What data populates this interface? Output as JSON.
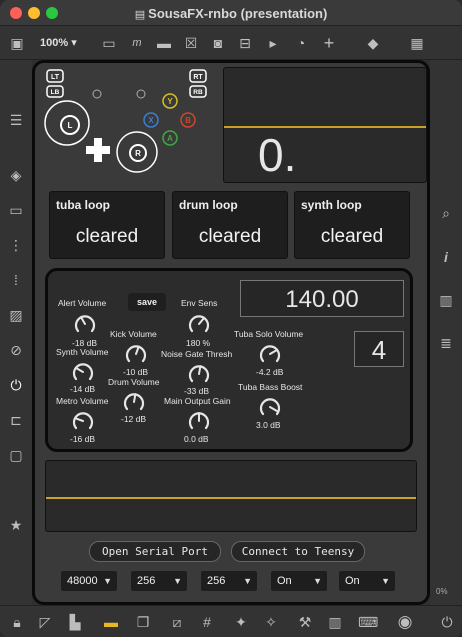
{
  "window": {
    "title": "SousaFX-rnbo (presentation)",
    "zoom": "100%"
  },
  "colors": {
    "accent": "#c9a227",
    "close": "#fe5f57",
    "minimize": "#febc2e",
    "maximize": "#28c840",
    "display_line": "#c9a227"
  },
  "toolbar": {
    "icons": [
      "sidebar-toggle-icon",
      "zoom-dropdown",
      "comment-box-icon",
      "message-icon",
      "speech-icon",
      "toggle-x-icon",
      "number-box-icon",
      "inlet-icon",
      "slider-icon",
      "dial-icon",
      "plus-icon",
      "paint-bucket-icon",
      "grid-icon"
    ]
  },
  "gamepad": {
    "lt": "LT",
    "lb": "LB",
    "rt": "RT",
    "rb": "RB",
    "left_stick": "L",
    "right_stick": "R",
    "y": "Y",
    "x": "X",
    "b": "B",
    "a": "A"
  },
  "display_top": {
    "value": "0."
  },
  "loops": [
    {
      "title": "tuba loop",
      "status": "cleared"
    },
    {
      "title": "drum loop",
      "status": "cleared"
    },
    {
      "title": "synth loop",
      "status": "cleared"
    }
  ],
  "mixer": {
    "save_label": "save",
    "tempo": "140.00",
    "beats": "4",
    "knobs": [
      {
        "label": "Alert Volume",
        "value": "-18 dB"
      },
      {
        "label": "Synth Volume",
        "value": "-14 dB"
      },
      {
        "label": "Metro Volume",
        "value": "-16 dB"
      },
      {
        "label": "Kick Volume",
        "value": "-10 dB"
      },
      {
        "label": "Drum Volume",
        "value": "-12 dB"
      },
      {
        "label": "Env Sens",
        "value": "180 %"
      },
      {
        "label": "Noise Gate Thresh",
        "value": "-33 dB"
      },
      {
        "label": "Main Output Gain",
        "value": "0.0 dB"
      },
      {
        "label": "Tuba Solo Volume",
        "value": "-4.2 dB"
      },
      {
        "label": "Tuba Bass Boost",
        "value": "3.0 dB"
      }
    ]
  },
  "display_bottom": {
    "value": ""
  },
  "serial": {
    "open_label": "Open Serial Port",
    "connect_label": "Connect to Teensy"
  },
  "selects": [
    "48000",
    "256",
    "256",
    "On",
    "On"
  ],
  "status": {
    "cpu": "0%"
  }
}
